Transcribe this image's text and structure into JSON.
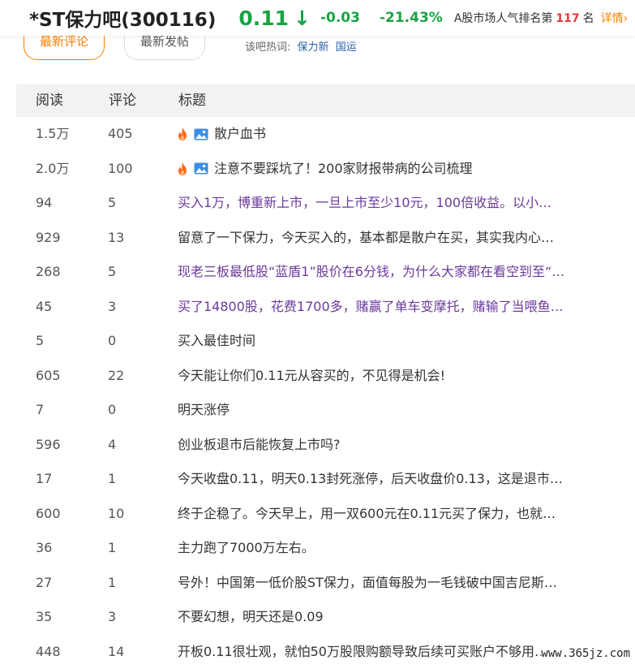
{
  "header": {
    "stock_name": "*ST保力吧(300116)",
    "price": "0.11",
    "arrow": "↓",
    "change": "-0.03",
    "change_pct": "-21.43%",
    "rank_prefix": "A股市场人气排名第",
    "rank_value": "117",
    "rank_suffix": "名",
    "detail_label": "详情",
    "detail_arrow": "›",
    "colors": {
      "down": "#1aa244",
      "accent": "#ff7e00",
      "rank": "#e4393c"
    }
  },
  "tabs": {
    "latest_comment": "最新评论",
    "latest_post": "最新发帖"
  },
  "hot": {
    "label": "该吧热词:",
    "words": [
      "保力新",
      "国运"
    ]
  },
  "table": {
    "headers": {
      "read": "阅读",
      "comment": "评论",
      "title": "标题"
    },
    "rows": [
      {
        "read": "1.5万",
        "comment": "405",
        "title": "散户血书",
        "hot": true,
        "visited": false
      },
      {
        "read": "2.0万",
        "comment": "100",
        "title": "注意不要踩坑了！200家财报带病的公司梳理",
        "hot": true,
        "visited": false
      },
      {
        "read": "94",
        "comment": "5",
        "title": "买入1万，博重新上市，一旦上市至少10元，100倍收益。以小…",
        "hot": false,
        "visited": true
      },
      {
        "read": "929",
        "comment": "13",
        "title": "留意了一下保力，今天买入的，基本都是散户在买，其实我内心…",
        "hot": false,
        "visited": false
      },
      {
        "read": "268",
        "comment": "5",
        "title": "现老三板最低股“蓝盾1”股价在6分钱，为什么大家都在看空到至“…",
        "hot": false,
        "visited": true
      },
      {
        "read": "45",
        "comment": "3",
        "title": "买了14800股，花费1700多，赌赢了单车变摩托，赌输了当喂鱼…",
        "hot": false,
        "visited": true
      },
      {
        "read": "5",
        "comment": "0",
        "title": "买入最佳时间",
        "hot": false,
        "visited": false
      },
      {
        "read": "605",
        "comment": "22",
        "title": "今天能让你们0.11元从容买的，不见得是机会!",
        "hot": false,
        "visited": false
      },
      {
        "read": "7",
        "comment": "0",
        "title": "明天涨停",
        "hot": false,
        "visited": false
      },
      {
        "read": "596",
        "comment": "4",
        "title": "创业板退市后能恢复上市吗?",
        "hot": false,
        "visited": false
      },
      {
        "read": "17",
        "comment": "1",
        "title": "今天收盘0.11，明天0.13封死涨停，后天收盘价0.13，这是退市…",
        "hot": false,
        "visited": false
      },
      {
        "read": "600",
        "comment": "10",
        "title": "终于企稳了。今天早上，用一双600元在0.11元买了保力，也就…",
        "hot": false,
        "visited": false
      },
      {
        "read": "36",
        "comment": "1",
        "title": "主力跑了7000万左右。",
        "hot": false,
        "visited": false
      },
      {
        "read": "27",
        "comment": "1",
        "title": "号外！中国第一低价股ST保力，面值每股为一毛钱破中国吉尼斯…",
        "hot": false,
        "visited": false
      },
      {
        "read": "35",
        "comment": "3",
        "title": "不要幻想，明天还是0.09",
        "hot": false,
        "visited": false
      },
      {
        "read": "448",
        "comment": "14",
        "title": "开板0.11很壮观，就怕50万股限购额导致后续可买账户不够用…",
        "hot": false,
        "visited": false
      }
    ]
  },
  "watermark": "www.365jz.com"
}
